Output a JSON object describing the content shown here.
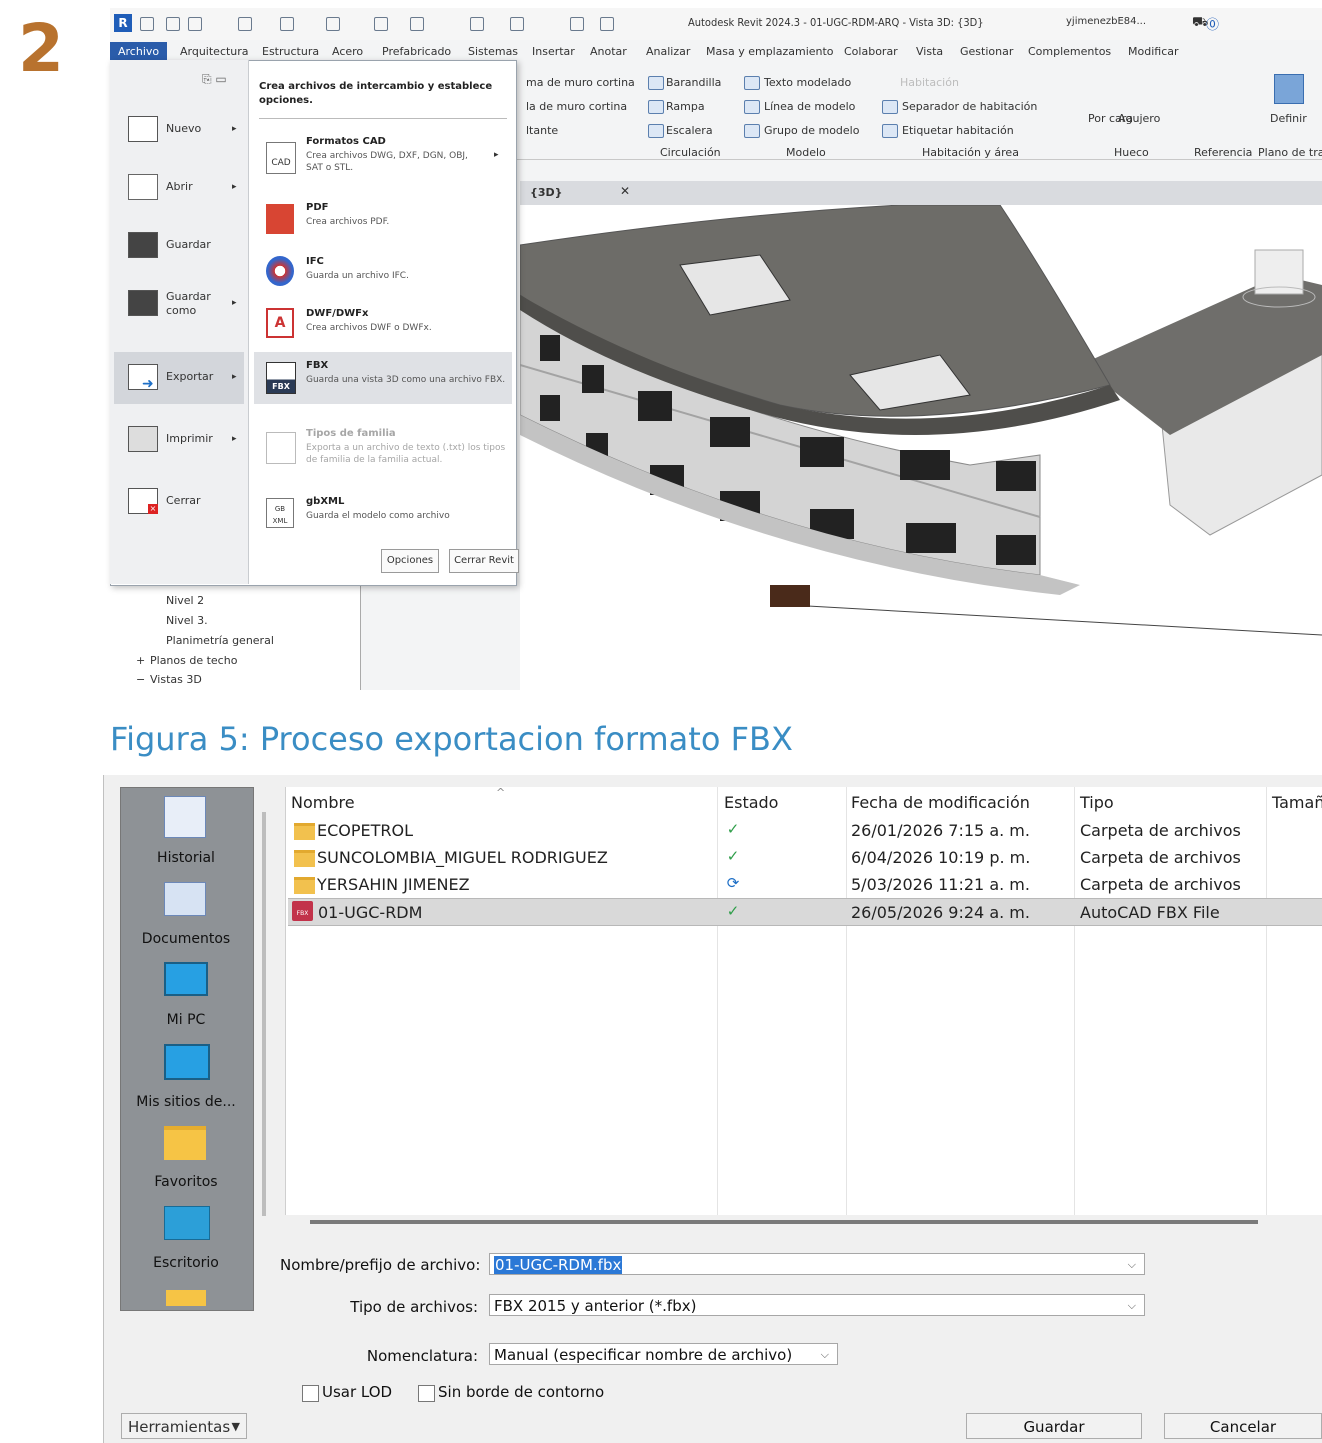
{
  "step_number": "2",
  "revit": {
    "title": "Autodesk Revit 2024.3 - 01-UGC-RDM-ARQ - Vista 3D: {3D}",
    "user": "yjimenezbE84...",
    "tabs": [
      "Archivo",
      "Arquitectura",
      "Estructura",
      "Acero",
      "Prefabricado",
      "Sistemas",
      "Insertar",
      "Anotar",
      "Analizar",
      "Masa y emplazamiento",
      "Colaborar",
      "Vista",
      "Gestionar",
      "Complementos",
      "Modificar"
    ],
    "ribbon": {
      "items": [
        "ma de muro cortina",
        "la de muro cortina",
        "ltante",
        "Barandilla",
        "Rampa",
        "Escalera",
        "Texto modelado",
        "Línea de modelo",
        "Grupo de modelo",
        "Habitación",
        "Separador de habitación",
        "Etiquetar habitación",
        "Por cara",
        "Agujero",
        "Definir"
      ],
      "groups": [
        "Circulación",
        "Modelo",
        "Habitación y área",
        "Hueco",
        "Referencia",
        "Plano de tral"
      ]
    },
    "view_tab": "{3D}",
    "browser_items": [
      "Nivel 2",
      "Nivel 3.",
      "Planimetría general",
      "Planos de techo",
      "Vistas 3D"
    ],
    "file_menu": {
      "left_items": [
        {
          "label": "Nuevo",
          "arrow": "▸"
        },
        {
          "label": "Abrir",
          "arrow": "▸"
        },
        {
          "label": "Guardar",
          "arrow": ""
        },
        {
          "label": "Guardar como",
          "arrow": "▸"
        },
        {
          "label": "Exportar",
          "arrow": "▸"
        },
        {
          "label": "Imprimir",
          "arrow": "▸"
        },
        {
          "label": "Cerrar",
          "arrow": ""
        }
      ],
      "header": "Crea archivos de intercambio y establece opciones.",
      "export_items": [
        {
          "title": "Formatos CAD",
          "desc": "Crea archivos DWG, DXF, DGN, OBJ, SAT o STL.",
          "icon": "CAD"
        },
        {
          "title": "PDF",
          "desc": "Crea archivos PDF.",
          "icon": ""
        },
        {
          "title": "IFC",
          "desc": "Guarda un archivo IFC.",
          "icon": ""
        },
        {
          "title": "DWF/DWFx",
          "desc": "Crea archivos DWF o DWFx.",
          "icon": "A"
        },
        {
          "title": "FBX",
          "desc": "Guarda una vista 3D como una archivo FBX.",
          "icon": "FBX"
        },
        {
          "title": "Tipos de familia",
          "desc": "Exporta a un archivo de texto (.txt) los tipos de familia de la familia actual.",
          "icon": ""
        },
        {
          "title": "gbXML",
          "desc": "Guarda el modelo como archivo",
          "icon": "GB XML"
        }
      ],
      "options_button": "Opciones",
      "exit_button": "Cerrar Revit"
    }
  },
  "caption": "Figura 5: Proceso exportacion formato FBX",
  "save_dialog": {
    "places": [
      "Historial",
      "Documentos",
      "Mi PC",
      "Mis sitios de...",
      "Favoritos",
      "Escritorio"
    ],
    "columns": [
      "Nombre",
      "Estado",
      "Fecha de modificación",
      "Tipo",
      "Tamañ"
    ],
    "files": [
      {
        "name": "ECOPETROL",
        "status": "ok",
        "date": "26/01/2026 7:15 a. m.",
        "type": "Carpeta de archivos",
        "kind": "folder"
      },
      {
        "name": "SUNCOLOMBIA_MIGUEL RODRIGUEZ",
        "status": "ok",
        "date": "6/04/2026 10:19 p. m.",
        "type": "Carpeta de archivos",
        "kind": "folder"
      },
      {
        "name": "YERSAHIN JIMENEZ",
        "status": "sync",
        "date": "5/03/2026 11:21 a. m.",
        "type": "Carpeta de archivos",
        "kind": "folder"
      },
      {
        "name": "01-UGC-RDM",
        "status": "ok",
        "date": "26/05/2026 9:24 a. m.",
        "type": "AutoCAD FBX File",
        "kind": "fbx"
      }
    ],
    "filename_label": "Nombre/prefijo de archivo:",
    "filename_value": "01-UGC-RDM.fbx",
    "filetype_label": "Tipo de archivos:",
    "filetype_value": "FBX 2015 y anterior  (*.fbx)",
    "naming_label": "Nomenclatura:",
    "naming_value": "Manual (especificar nombre de archivo)",
    "use_lod_label": "Usar LOD",
    "no_border_label": "Sin borde de contorno",
    "tools_label": "Herramientas",
    "save_button": "Guardar",
    "cancel_button": "Cancelar"
  }
}
